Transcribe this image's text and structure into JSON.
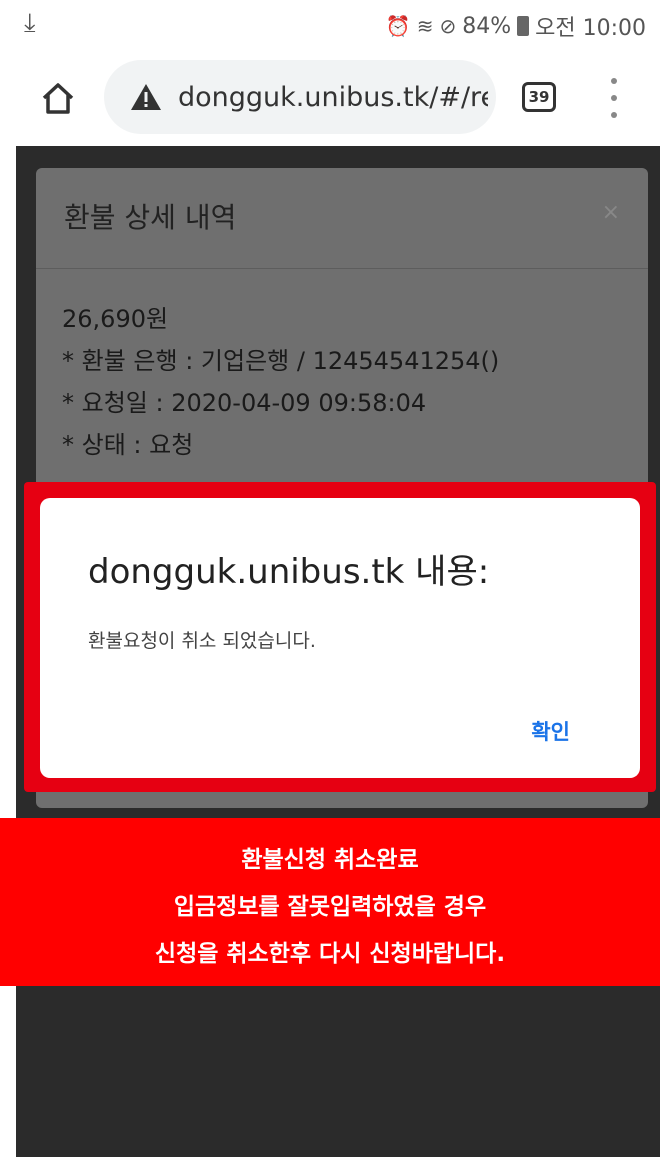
{
  "status_bar": {
    "download_icon": "download-arrow-icon",
    "alarm_icon": "alarm-icon",
    "wifi_icon": "wifi-icon",
    "dnd_icon": "do-not-disturb-icon",
    "battery_percent": "84%",
    "time": "오전 10:00"
  },
  "browser": {
    "url": "dongguk.unibus.tk/#/re",
    "tab_count": "39",
    "home_icon": "home-icon",
    "security_icon": "warning-triangle-icon",
    "menu_icon": "more-vertical-icon"
  },
  "modal": {
    "title": "환불 상세 내역",
    "close_symbol": "×",
    "amount": "26,690원",
    "bank_line": "* 환불 은행 : 기업은행 / 12454541254()",
    "date_line": "* 요청일 : 2020-04-09 09:58:04",
    "status_line": "* 상태 : 요청"
  },
  "alert": {
    "title": "dongguk.unibus.tk 내용:",
    "message": "환불요청이 취소 되었습니다.",
    "ok_label": "확인"
  },
  "banner": {
    "line1": "환불신청 취소완료",
    "line2": "입금정보를 잘못입력하였을 경우",
    "line3": "신청을 취소한후 다시 신청바랍니다."
  },
  "colors": {
    "highlight": "#e60012",
    "banner_bg": "#ff0000",
    "link_blue": "#1a73e8"
  }
}
